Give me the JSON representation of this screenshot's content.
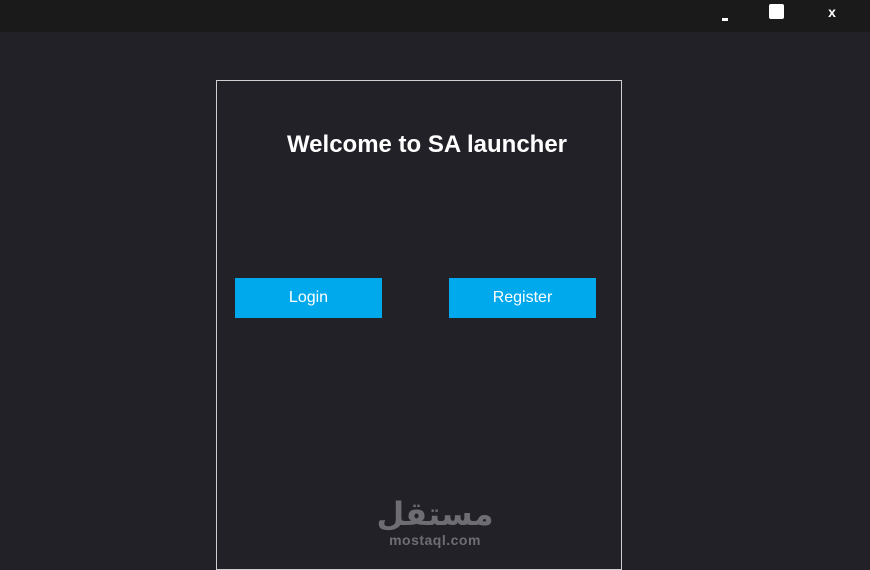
{
  "window": {
    "minimize_label": "-",
    "maximize_label": "",
    "close_label": "x"
  },
  "main": {
    "welcome_text": "Welcome to SA launcher",
    "login_label": "Login",
    "register_label": "Register"
  },
  "watermark": {
    "arabic": "مستقل",
    "latin": "mostaql.com"
  },
  "colors": {
    "background": "#232128",
    "titlebar": "#1a1a1a",
    "button": "#00a8ec",
    "panel_border": "#cfcfcf"
  }
}
